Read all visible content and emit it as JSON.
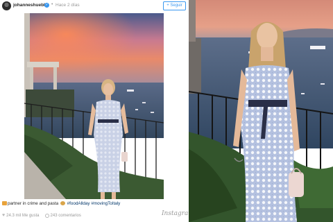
{
  "post": {
    "username": "johanneshuebl",
    "time": "Hace 2 días",
    "follow_label": "+ Seguir",
    "caption": {
      "text": "partner in crime and pasta",
      "hashtags": [
        "#foodAllday",
        "#movingToItaly"
      ]
    },
    "stats": {
      "likes": "24.3 mil Me gusta",
      "comments": "243 comentarios"
    },
    "logo": "Instagram"
  },
  "icons": [
    "avatar",
    "verified-icon",
    "heart-icon",
    "comment-icon",
    "emoji-icon"
  ],
  "colors": {
    "accent": "#3897f0",
    "hashtag": "#003569",
    "muted": "#999999"
  }
}
